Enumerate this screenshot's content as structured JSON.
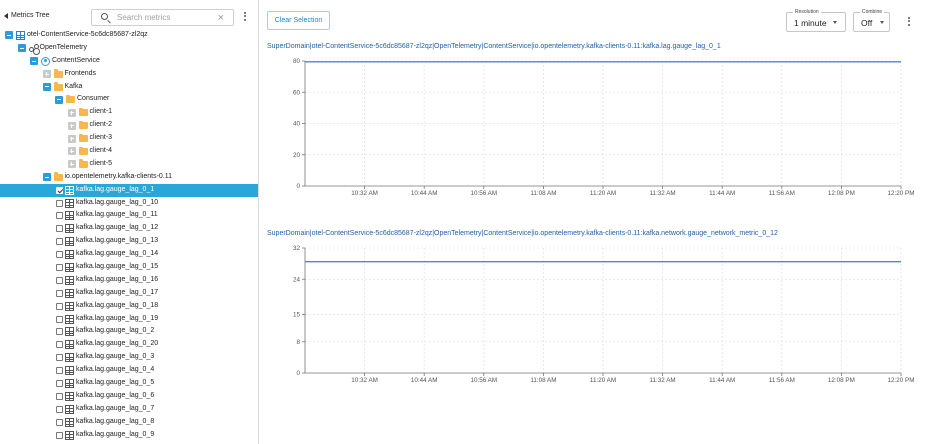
{
  "left_panel": {
    "title": "Metrics Tree",
    "search_placeholder": "Search metrics",
    "clear_glyph": "×",
    "tree": [
      {
        "label": "otel-ContentService-5c6dc85687-zl2qz",
        "depth": 0,
        "kind": "root",
        "expanded": true
      },
      {
        "label": "OpenTelemetry",
        "depth": 1,
        "kind": "otel",
        "expanded": true
      },
      {
        "label": "ContentService",
        "depth": 2,
        "kind": "service",
        "expanded": true
      },
      {
        "label": "Frontends",
        "depth": 3,
        "kind": "folder",
        "expanded": false
      },
      {
        "label": "Kafka",
        "depth": 3,
        "kind": "folder",
        "expanded": true
      },
      {
        "label": "Consumer",
        "depth": 4,
        "kind": "folder",
        "expanded": true
      },
      {
        "label": "client-1",
        "depth": 5,
        "kind": "folder",
        "expanded": false
      },
      {
        "label": "client-2",
        "depth": 5,
        "kind": "folder",
        "expanded": false
      },
      {
        "label": "client-3",
        "depth": 5,
        "kind": "folder",
        "expanded": false
      },
      {
        "label": "client-4",
        "depth": 5,
        "kind": "folder",
        "expanded": false
      },
      {
        "label": "client-5",
        "depth": 5,
        "kind": "folder",
        "expanded": false
      },
      {
        "label": "io.opentelemetry.kafka-clients-0.11",
        "depth": 3,
        "kind": "folder",
        "expanded": true
      },
      {
        "label": "kafka.lag.gauge_lag_0_1",
        "depth": 4,
        "kind": "metric",
        "checked": true,
        "selected": true
      },
      {
        "label": "kafka.lag.gauge_lag_0_10",
        "depth": 4,
        "kind": "metric",
        "checked": false
      },
      {
        "label": "kafka.lag.gauge_lag_0_11",
        "depth": 4,
        "kind": "metric",
        "checked": false
      },
      {
        "label": "kafka.lag.gauge_lag_0_12",
        "depth": 4,
        "kind": "metric",
        "checked": false
      },
      {
        "label": "kafka.lag.gauge_lag_0_13",
        "depth": 4,
        "kind": "metric",
        "checked": false
      },
      {
        "label": "kafka.lag.gauge_lag_0_14",
        "depth": 4,
        "kind": "metric",
        "checked": false
      },
      {
        "label": "kafka.lag.gauge_lag_0_15",
        "depth": 4,
        "kind": "metric",
        "checked": false
      },
      {
        "label": "kafka.lag.gauge_lag_0_16",
        "depth": 4,
        "kind": "metric",
        "checked": false
      },
      {
        "label": "kafka.lag.gauge_lag_0_17",
        "depth": 4,
        "kind": "metric",
        "checked": false
      },
      {
        "label": "kafka.lag.gauge_lag_0_18",
        "depth": 4,
        "kind": "metric",
        "checked": false
      },
      {
        "label": "kafka.lag.gauge_lag_0_19",
        "depth": 4,
        "kind": "metric",
        "checked": false
      },
      {
        "label": "kafka.lag.gauge_lag_0_2",
        "depth": 4,
        "kind": "metric",
        "checked": false
      },
      {
        "label": "kafka.lag.gauge_lag_0_20",
        "depth": 4,
        "kind": "metric",
        "checked": false
      },
      {
        "label": "kafka.lag.gauge_lag_0_3",
        "depth": 4,
        "kind": "metric",
        "checked": false
      },
      {
        "label": "kafka.lag.gauge_lag_0_4",
        "depth": 4,
        "kind": "metric",
        "checked": false
      },
      {
        "label": "kafka.lag.gauge_lag_0_5",
        "depth": 4,
        "kind": "metric",
        "checked": false
      },
      {
        "label": "kafka.lag.gauge_lag_0_6",
        "depth": 4,
        "kind": "metric",
        "checked": false
      },
      {
        "label": "kafka.lag.gauge_lag_0_7",
        "depth": 4,
        "kind": "metric",
        "checked": false
      },
      {
        "label": "kafka.lag.gauge_lag_0_8",
        "depth": 4,
        "kind": "metric",
        "checked": false
      },
      {
        "label": "kafka.lag.gauge_lag_0_9",
        "depth": 4,
        "kind": "metric",
        "checked": false
      }
    ]
  },
  "toolbar": {
    "clear_selection_label": "Clear Selection",
    "resolution_label": "Resolution",
    "resolution_value": "1 minute",
    "combine_label": "Combine",
    "combine_value": "Off"
  },
  "colors": {
    "accent": "#29a7d8",
    "series_line": "#4a86e8",
    "title_text": "#1f5fa8"
  },
  "chart_data": [
    {
      "type": "line",
      "title": "SuperDomain|otel-ContentService-5c6dc85687-zl2qz|OpenTelemetry|ContentService|io.opentelemetry.kafka-clients-0.11:kafka.lag.gauge_lag_0_1",
      "x_ticks": [
        "10:32 AM",
        "10:44 AM",
        "10:56 AM",
        "11:08 AM",
        "11:20 AM",
        "11:32 AM",
        "11:44 AM",
        "11:56 AM",
        "12:08 PM",
        "12:20 PM"
      ],
      "y_ticks": [
        "0",
        "20",
        "40",
        "60",
        "80"
      ],
      "ylim": [
        0,
        80
      ],
      "series": [
        {
          "values": [
            79.5,
            79.5
          ]
        }
      ]
    },
    {
      "type": "line",
      "title": "SuperDomain|otel-ContentService-5c6dc85687-zl2qz|OpenTelemetry|ContentService|io.opentelemetry.kafka-clients-0.11:kafka.network.gauge_network_metric_0_12",
      "x_ticks": [
        "10:32 AM",
        "10:44 AM",
        "10:56 AM",
        "11:08 AM",
        "11:20 AM",
        "11:32 AM",
        "11:44 AM",
        "11:56 AM",
        "12:08 PM",
        "12:20 PM"
      ],
      "y_ticks": [
        "0",
        "8",
        "15",
        "24",
        "32"
      ],
      "ylim": [
        0,
        32
      ],
      "series": [
        {
          "values": [
            28.5,
            28.5
          ]
        }
      ]
    }
  ]
}
